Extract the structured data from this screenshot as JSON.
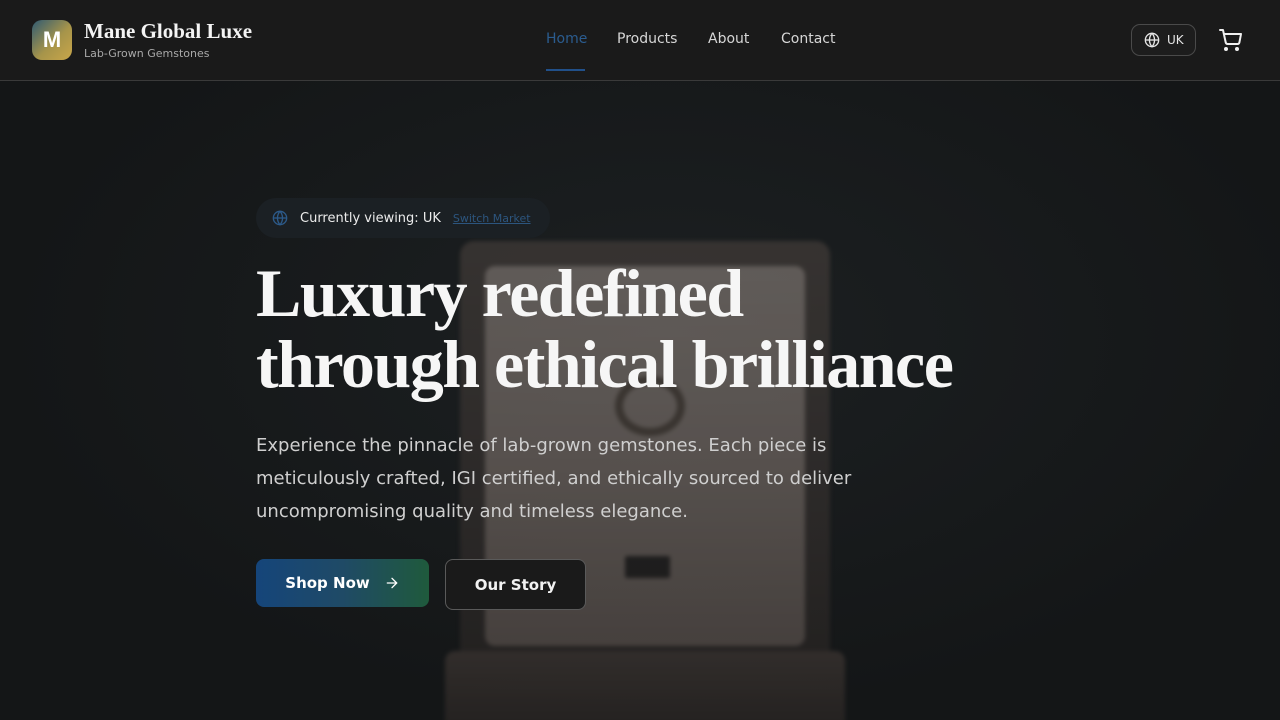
{
  "brand": {
    "logo_letter": "M",
    "title": "Mane Global Luxe",
    "subtitle": "Lab-Grown Gemstones"
  },
  "nav": {
    "items": [
      {
        "label": "Home",
        "active": true
      },
      {
        "label": "Products",
        "active": false
      },
      {
        "label": "About",
        "active": false
      },
      {
        "label": "Contact",
        "active": false
      }
    ]
  },
  "market": {
    "code": "UK",
    "icon": "globe-icon"
  },
  "cart": {
    "icon": "cart-icon"
  },
  "hero": {
    "viewing_text": "Currently viewing: UK",
    "switch_label": "Switch Market",
    "headline_line1": "Luxury redefined",
    "headline_line2": "through ethical brilliance",
    "subtext": "Experience the pinnacle of lab-grown gemstones. Each piece is meticulously crafted, IGI certified, and ethically sourced to deliver uncompromising quality and timeless elegance.",
    "primary_button": "Shop Now",
    "secondary_button": "Our Story"
  },
  "colors": {
    "background": "#151718",
    "header": "#1a1a1a",
    "nav_active": "#2b5c8f",
    "primary_gradient_start": "#15457a",
    "primary_gradient_end": "#1f5a3c"
  }
}
